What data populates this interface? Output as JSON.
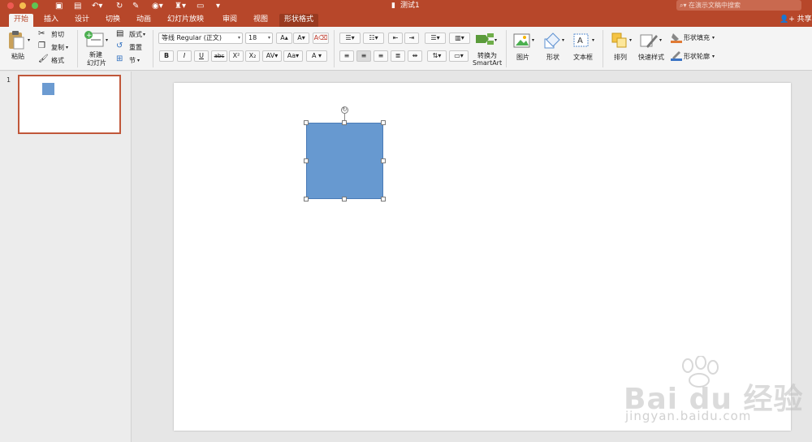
{
  "app": {
    "document_title": "测试1",
    "search_placeholder": "在演示文稿中搜索",
    "share_label": "共享"
  },
  "tabs": [
    {
      "label": "开始"
    },
    {
      "label": "插入"
    },
    {
      "label": "设计"
    },
    {
      "label": "切换"
    },
    {
      "label": "动画"
    },
    {
      "label": "幻灯片放映"
    },
    {
      "label": "审阅"
    },
    {
      "label": "视图"
    },
    {
      "label": "形状格式"
    }
  ],
  "ribbon": {
    "paste_label": "粘贴",
    "cut_label": "剪切",
    "copy_label": "复制",
    "format_painter_label": "格式",
    "new_slide_label_1": "新建",
    "new_slide_label_2": "幻灯片",
    "layout_label": "版式",
    "reset_label": "重置",
    "section_label": "节",
    "font_name": "等线 Regular (正文)",
    "font_size": "18",
    "bold": "B",
    "italic": "I",
    "underline": "U",
    "strike": "abc",
    "superscript": "X²",
    "subscript": "X₂",
    "convert_smartart_1": "转换为",
    "convert_smartart_2": "SmartArt",
    "picture_label": "图片",
    "shape_label": "形状",
    "textbox_label": "文本框",
    "arrange_label": "排列",
    "quick_styles_label": "快速样式",
    "shape_fill_label": "形状填充",
    "shape_outline_label": "形状轮廓"
  },
  "slides_panel": {
    "slide_number": "1"
  },
  "colors": {
    "accent": "#b7472a",
    "shape_fill": "#6799d0"
  },
  "watermark": {
    "main": "Bai du 经验",
    "sub": "jingyan.baidu.com"
  }
}
